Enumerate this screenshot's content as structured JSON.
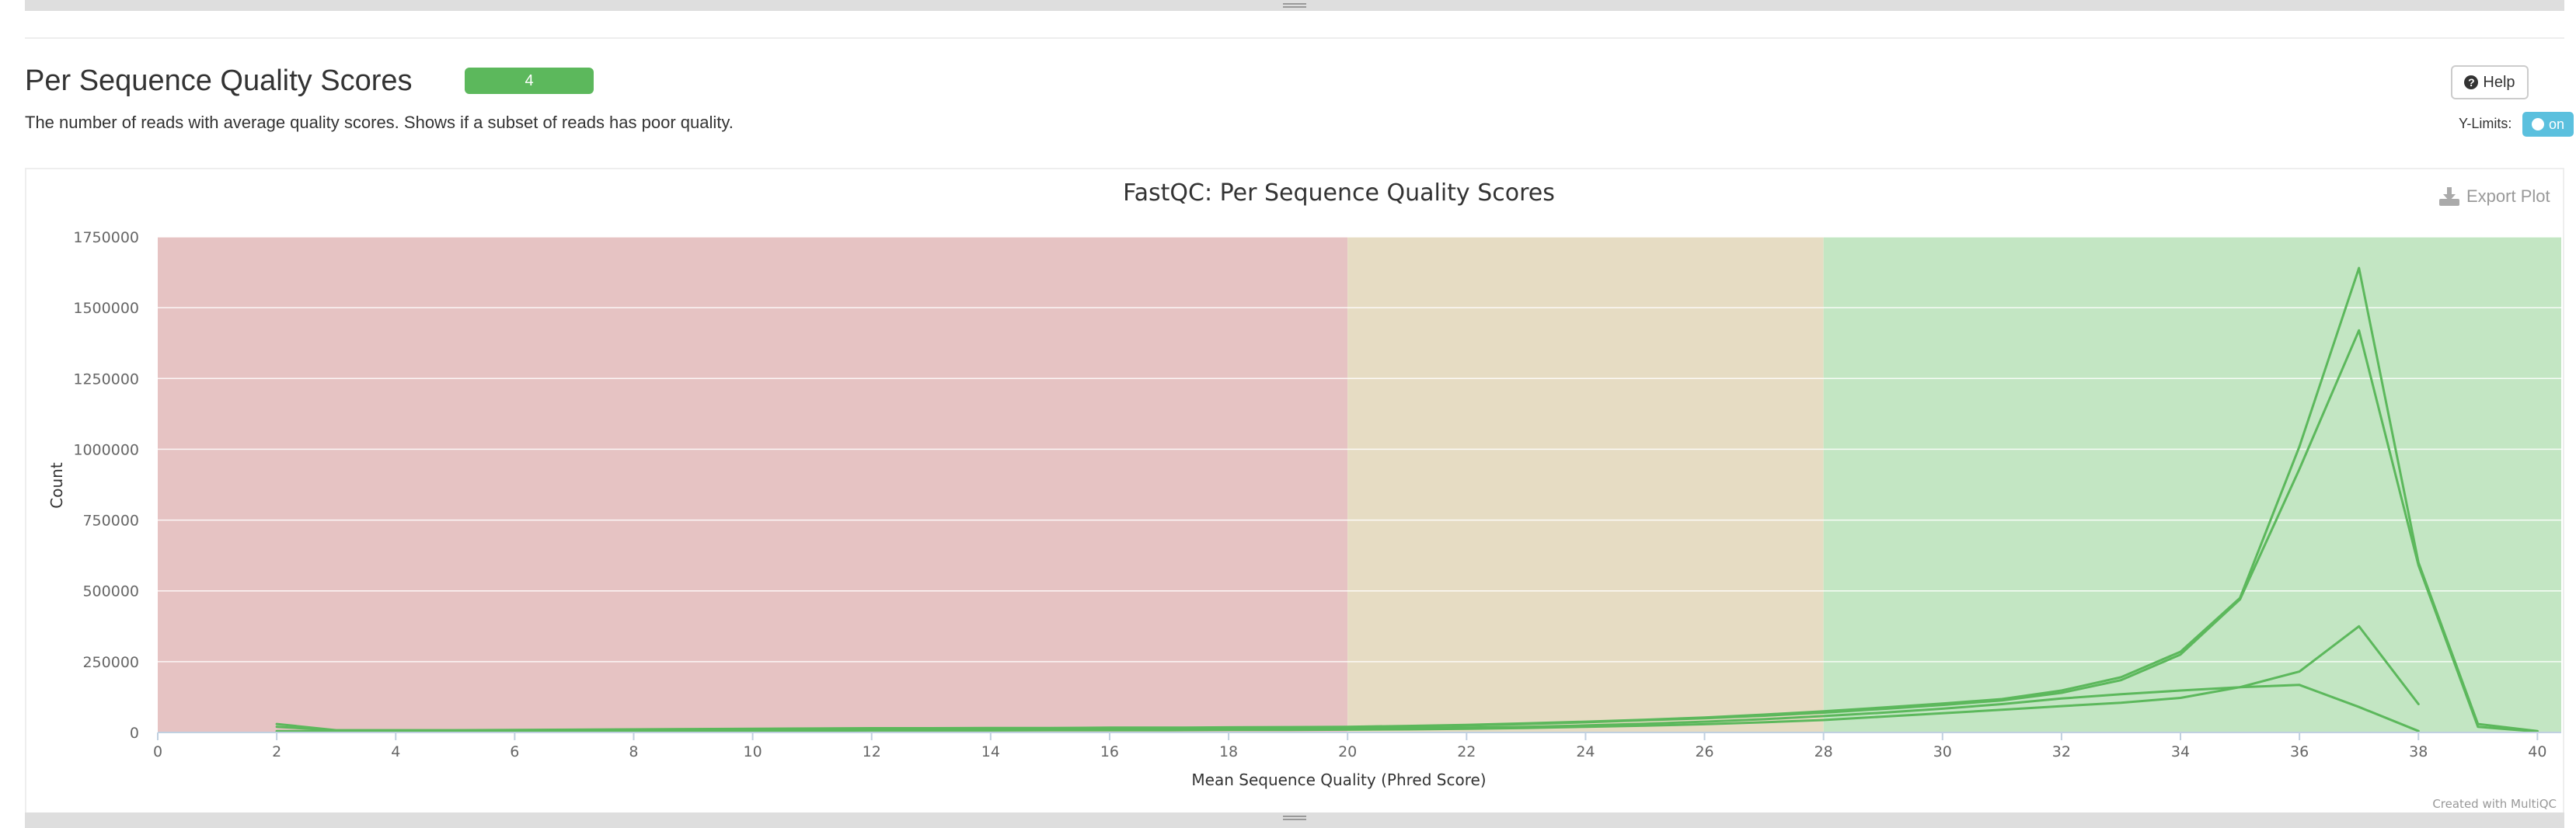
{
  "section": {
    "title": "Per Sequence Quality Scores",
    "badge": "4",
    "description": "The number of reads with average quality scores. Shows if a subset of reads has poor quality."
  },
  "controls": {
    "help_label": "Help",
    "ylimits_label": "Y-Limits:",
    "ylimits_toggle_label": "on",
    "export_label": "Export Plot"
  },
  "colors": {
    "series": "#5cb85c",
    "zone_fail": "#e6c3c3",
    "zone_warn": "#e6dcc3",
    "zone_pass": "#c3e6c3",
    "badge": "#5cb85c",
    "toggle": "#5bc0de"
  },
  "credit": "Created with MultiQC",
  "chart_data": {
    "type": "line",
    "title": "FastQC: Per Sequence Quality Scores",
    "xlabel": "Mean Sequence Quality (Phred Score)",
    "ylabel": "Count",
    "xlim": [
      0,
      40.4
    ],
    "ylim": [
      0,
      1750000
    ],
    "x_ticks": [
      0,
      2,
      4,
      6,
      8,
      10,
      12,
      14,
      16,
      18,
      20,
      22,
      24,
      26,
      28,
      30,
      32,
      34,
      36,
      38,
      40
    ],
    "y_ticks": [
      0,
      250000,
      500000,
      750000,
      1000000,
      1250000,
      1500000,
      1750000
    ],
    "y_tick_labels": [
      "0",
      "250000",
      "500000",
      "750000",
      "1000000",
      "1250000",
      "1500000",
      "1750000"
    ],
    "grid": true,
    "legend": "none",
    "bands": [
      {
        "from": 0,
        "to": 20,
        "status": "fail"
      },
      {
        "from": 20,
        "to": 28,
        "status": "warn"
      },
      {
        "from": 28,
        "to": 40.4,
        "status": "pass"
      }
    ],
    "series": [
      {
        "x": [
          2,
          3,
          4,
          5,
          6,
          7,
          8,
          9,
          10,
          11,
          12,
          13,
          14,
          15,
          16,
          17,
          18,
          19,
          20,
          21,
          22,
          23,
          24,
          25,
          26,
          27,
          28,
          29,
          30,
          31,
          32,
          33,
          34,
          35,
          36,
          37,
          38,
          39,
          40
        ],
        "values": [
          30000,
          8000,
          8000,
          8000,
          9000,
          10000,
          11000,
          12000,
          13000,
          14000,
          15000,
          15000,
          16000,
          16000,
          17000,
          17000,
          18000,
          19000,
          20000,
          23000,
          27000,
          32000,
          38000,
          45000,
          53000,
          63000,
          75000,
          88000,
          102000,
          118000,
          148000,
          195000,
          285000,
          475000,
          1010000,
          1640000,
          600000,
          30000,
          5000
        ]
      },
      {
        "x": [
          2,
          3,
          4,
          5,
          6,
          7,
          8,
          9,
          10,
          11,
          12,
          13,
          14,
          15,
          16,
          17,
          18,
          19,
          20,
          21,
          22,
          23,
          24,
          25,
          26,
          27,
          28,
          29,
          30,
          31,
          32,
          33,
          34,
          35,
          36,
          37,
          38,
          39,
          40
        ],
        "values": [
          20000,
          7000,
          7000,
          7000,
          8000,
          9000,
          10000,
          11000,
          12000,
          13000,
          13000,
          14000,
          14000,
          15000,
          15000,
          16000,
          16000,
          17000,
          18000,
          21000,
          25000,
          30000,
          36000,
          43000,
          50000,
          59000,
          70000,
          83000,
          97000,
          113000,
          140000,
          185000,
          275000,
          470000,
          930000,
          1420000,
          590000,
          20000,
          3000
        ]
      },
      {
        "x": [
          2,
          3,
          4,
          5,
          6,
          7,
          8,
          9,
          10,
          11,
          12,
          13,
          14,
          15,
          16,
          17,
          18,
          19,
          20,
          21,
          22,
          23,
          24,
          25,
          26,
          27,
          28,
          29,
          30,
          31,
          32,
          33,
          34,
          35,
          36,
          37,
          38
        ],
        "values": [
          5000,
          4000,
          4000,
          5000,
          5000,
          6000,
          6000,
          7000,
          7000,
          8000,
          8000,
          8000,
          9000,
          9000,
          9000,
          10000,
          10000,
          11000,
          12000,
          14000,
          17000,
          20000,
          25000,
          31000,
          38000,
          47000,
          58000,
          70000,
          84000,
          100000,
          120000,
          135000,
          148000,
          160000,
          215000,
          375000,
          100000
        ]
      },
      {
        "x": [
          2,
          3,
          4,
          5,
          6,
          7,
          8,
          9,
          10,
          11,
          12,
          13,
          14,
          15,
          16,
          17,
          18,
          19,
          20,
          21,
          22,
          23,
          24,
          25,
          26,
          27,
          28,
          29,
          30,
          31,
          32,
          33,
          34,
          35,
          36,
          37,
          38
        ],
        "values": [
          4000,
          3000,
          3000,
          4000,
          4000,
          5000,
          5000,
          6000,
          6000,
          6000,
          7000,
          7000,
          7000,
          8000,
          8000,
          8000,
          9000,
          9000,
          10000,
          11000,
          13000,
          16000,
          20000,
          24000,
          29000,
          36000,
          44000,
          56000,
          68000,
          80000,
          93000,
          105000,
          122000,
          160000,
          168000,
          90000,
          5000
        ]
      }
    ]
  }
}
